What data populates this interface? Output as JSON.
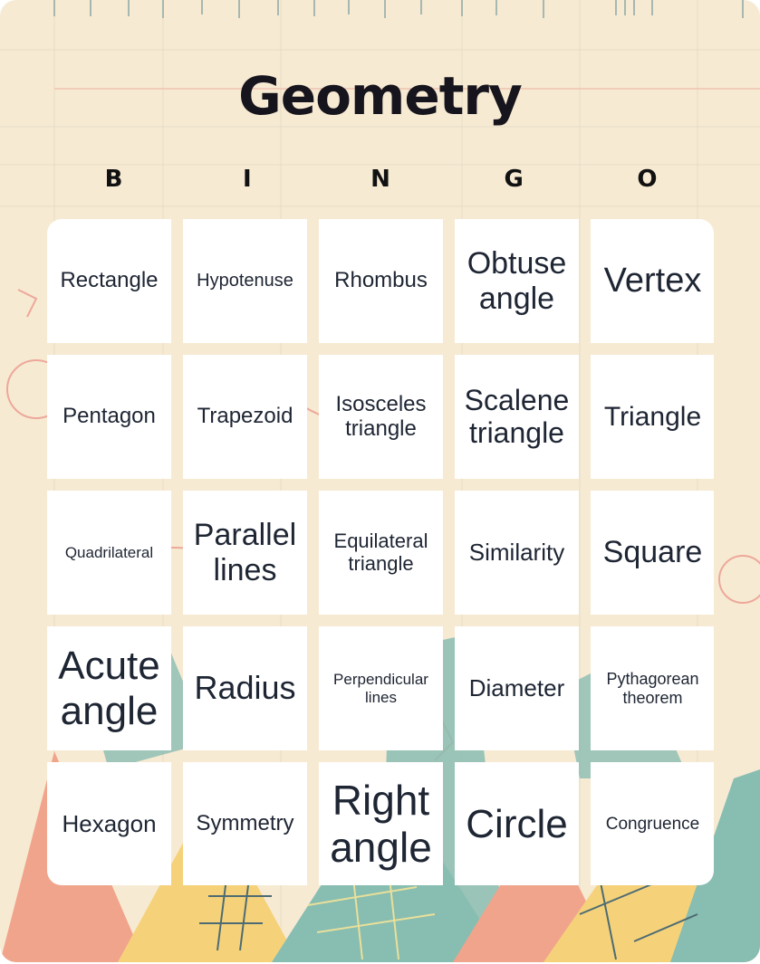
{
  "title": "Geometry",
  "header_letters": [
    "B",
    "I",
    "N",
    "G",
    "O"
  ],
  "cells": [
    {
      "text": "Rectangle",
      "size": 24
    },
    {
      "text": "Hypotenuse",
      "size": 20
    },
    {
      "text": "Rhombus",
      "size": 24
    },
    {
      "text": "Obtuse angle",
      "size": 34
    },
    {
      "text": "Vertex",
      "size": 38
    },
    {
      "text": "Pentagon",
      "size": 24
    },
    {
      "text": "Trapezoid",
      "size": 24
    },
    {
      "text": "Isosceles triangle",
      "size": 24
    },
    {
      "text": "Scalene triangle",
      "size": 32
    },
    {
      "text": "Triangle",
      "size": 30
    },
    {
      "text": "Quadrilateral",
      "size": 17
    },
    {
      "text": "Parallel lines",
      "size": 34
    },
    {
      "text": "Equilateral triangle",
      "size": 22
    },
    {
      "text": "Similarity",
      "size": 26
    },
    {
      "text": "Square",
      "size": 34
    },
    {
      "text": "Acute angle",
      "size": 44
    },
    {
      "text": "Radius",
      "size": 36
    },
    {
      "text": "Perpendicular lines",
      "size": 17
    },
    {
      "text": "Diameter",
      "size": 26
    },
    {
      "text": "Pythagorean theorem",
      "size": 18
    },
    {
      "text": "Hexagon",
      "size": 26
    },
    {
      "text": "Symmetry",
      "size": 24
    },
    {
      "text": "Right angle",
      "size": 46
    },
    {
      "text": "Circle",
      "size": 44
    },
    {
      "text": "Congruence",
      "size": 19
    }
  ]
}
